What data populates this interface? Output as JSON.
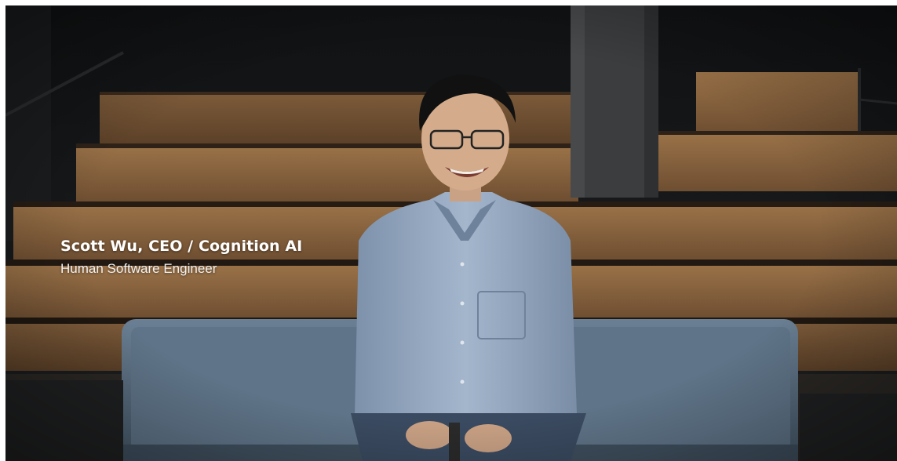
{
  "video": {
    "lower_third": {
      "name_line": "Scott Wu, CEO / Cognition AI",
      "role_line": "Human Software Engineer"
    }
  },
  "colors": {
    "wall": "#15171a",
    "wood": "#8a6440",
    "sofa": "#5d7287",
    "shirt": "#8fa3bd",
    "caption_text": "#ffffff"
  }
}
